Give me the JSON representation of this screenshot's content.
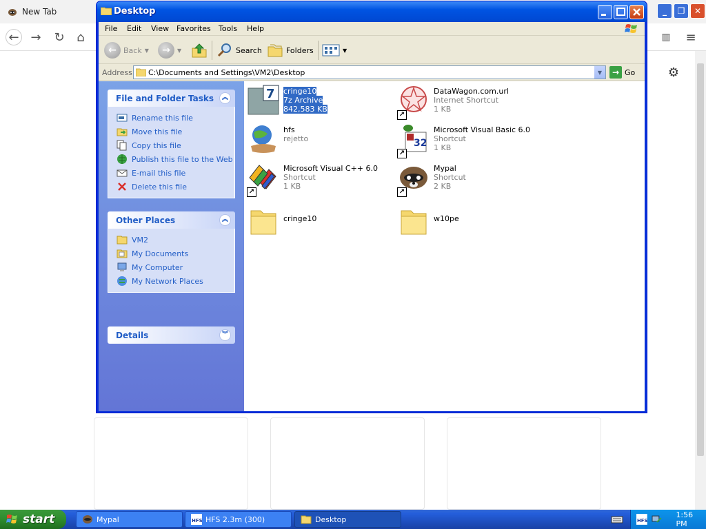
{
  "browser": {
    "tab_title": "New Tab"
  },
  "window": {
    "title": "Desktop"
  },
  "menu": [
    "File",
    "Edit",
    "View",
    "Favorites",
    "Tools",
    "Help"
  ],
  "toolbar": {
    "back": "Back",
    "search": "Search",
    "folders": "Folders"
  },
  "address": {
    "label": "Address",
    "path": "C:\\Documents and Settings\\VM2\\Desktop",
    "go": "Go"
  },
  "file_tasks": {
    "title": "File and Folder Tasks",
    "items": [
      {
        "label": "Rename this file",
        "icon": "rename-icon"
      },
      {
        "label": "Move this file",
        "icon": "move-icon"
      },
      {
        "label": "Copy this file",
        "icon": "copy-icon"
      },
      {
        "label": "Publish this file to the Web",
        "icon": "publish-icon"
      },
      {
        "label": "E-mail this file",
        "icon": "email-icon"
      },
      {
        "label": "Delete this file",
        "icon": "delete-icon"
      }
    ]
  },
  "other_places": {
    "title": "Other Places",
    "items": [
      {
        "label": "VM2",
        "icon": "folder-icon"
      },
      {
        "label": "My Documents",
        "icon": "my-documents-icon"
      },
      {
        "label": "My Computer",
        "icon": "my-computer-icon"
      },
      {
        "label": "My Network Places",
        "icon": "network-places-icon"
      }
    ]
  },
  "details": {
    "title": "Details"
  },
  "files": [
    {
      "name": "cringe10",
      "type": "7z Archive",
      "size": "842,583 KB",
      "icon": "7z-archive-icon",
      "selected": true
    },
    {
      "name": "DataWagon.com.url",
      "type": "Internet Shortcut",
      "size": "1 KB",
      "icon": "datawagon-icon"
    },
    {
      "name": "hfs",
      "type": "rejetto",
      "size": "",
      "icon": "hfs-icon"
    },
    {
      "name": "Microsoft Visual Basic 6.0",
      "type": "Shortcut",
      "size": "1 KB",
      "icon": "visual-basic-icon"
    },
    {
      "name": "Microsoft Visual C++ 6.0",
      "type": "Shortcut",
      "size": "1 KB",
      "icon": "visual-cpp-icon"
    },
    {
      "name": "Mypal",
      "type": "Shortcut",
      "size": "2 KB",
      "icon": "mypal-icon"
    },
    {
      "name": "cringe10",
      "type": "",
      "size": "",
      "icon": "folder-icon"
    },
    {
      "name": "w10pe",
      "type": "",
      "size": "",
      "icon": "folder-icon"
    }
  ],
  "taskbar": {
    "start": "start",
    "buttons": [
      {
        "label": "Mypal",
        "active": false
      },
      {
        "label": "HFS 2.3m (300)",
        "active": false
      },
      {
        "label": "Desktop",
        "active": true
      }
    ],
    "clock": "1:56 PM"
  }
}
